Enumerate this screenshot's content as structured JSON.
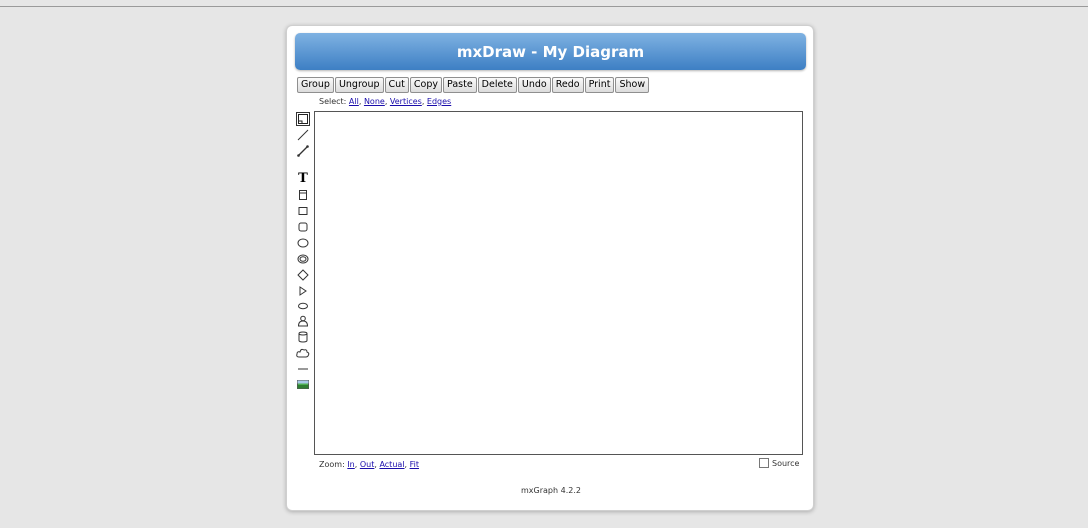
{
  "app": {
    "title": "mxDraw - My Diagram",
    "footer": "mxGraph 4.2.2"
  },
  "toolbar": {
    "buttons": [
      "Group",
      "Ungroup",
      "Cut",
      "Copy",
      "Paste",
      "Delete",
      "Undo",
      "Redo",
      "Print",
      "Show"
    ]
  },
  "select": {
    "label": "Select:",
    "links": [
      "All",
      "None",
      "Vertices",
      "Edges"
    ]
  },
  "zoom": {
    "label": "Zoom:",
    "links": [
      "In",
      "Out",
      "Actual",
      "Fit"
    ]
  },
  "source": {
    "label": "Source",
    "checked": false
  },
  "tools": [
    "container-icon",
    "connector-icon",
    "entity-relation-icon",
    "text-icon",
    "swimlane-icon",
    "rectangle-icon",
    "rounded-rectangle-icon",
    "ellipse-icon",
    "double-ellipse-icon",
    "rhombus-icon",
    "triangle-icon",
    "ellipse-small-icon",
    "actor-icon",
    "cylinder-icon",
    "cloud-icon",
    "hline-icon",
    "image-icon"
  ],
  "colors": {
    "title_start": "#7fb2e2",
    "title_end": "#3d7fc4",
    "link": "#1a0dab",
    "background": "#e6e6e6"
  }
}
